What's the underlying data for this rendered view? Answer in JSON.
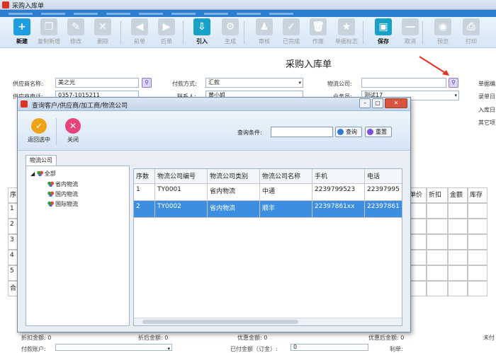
{
  "window": {
    "title": "采购入库单"
  },
  "toolbar": [
    {
      "label": "新建",
      "icon": "plus-icon",
      "state": "active",
      "color": "#1e9de0",
      "glyph": "+"
    },
    {
      "label": "复制新增",
      "icon": "copy-icon",
      "state": "disabled",
      "glyph": "❐"
    },
    {
      "label": "修改",
      "icon": "edit-icon",
      "state": "disabled",
      "glyph": "✎"
    },
    {
      "label": "删除",
      "icon": "delete-icon",
      "state": "disabled",
      "glyph": "✕"
    },
    {
      "label": "前单",
      "icon": "prev-icon",
      "state": "disabled",
      "glyph": "◀"
    },
    {
      "label": "后单",
      "icon": "next-icon",
      "state": "disabled",
      "glyph": "▶"
    },
    {
      "label": "引入",
      "icon": "import-icon",
      "state": "active",
      "color": "#19a2c9",
      "glyph": "⇩"
    },
    {
      "label": "生成",
      "icon": "generate-icon",
      "state": "disabled",
      "glyph": "⚙"
    },
    {
      "label": "审核",
      "icon": "audit-icon",
      "state": "disabled",
      "glyph": "♟"
    },
    {
      "label": "已完成",
      "icon": "check-icon",
      "state": "disabled",
      "glyph": "✓"
    },
    {
      "label": "作废",
      "icon": "void-icon",
      "state": "disabled",
      "glyph": "🗑"
    },
    {
      "label": "单据标志",
      "icon": "star-icon",
      "state": "disabled",
      "glyph": "★"
    },
    {
      "label": "保存",
      "icon": "save-icon",
      "state": "active",
      "color": "#19a2c9",
      "glyph": "▣"
    },
    {
      "label": "取消",
      "icon": "cancel-icon",
      "state": "disabled",
      "glyph": "—"
    },
    {
      "label": "预览",
      "icon": "preview-icon",
      "state": "disabled",
      "glyph": "◉"
    },
    {
      "label": "打印",
      "icon": "print-icon",
      "state": "disabled",
      "glyph": "⎙"
    }
  ],
  "form": {
    "title": "采购入库单",
    "supplier_name_label": "供应商名称:",
    "supplier_name": "美之光",
    "supplier_phone_label": "供应商电话:",
    "supplier_phone": "0357-1015211",
    "payment_label": "付款方式:",
    "payment": "汇款",
    "contact_label": "联系人:",
    "contact": "黄小姐",
    "logistics_label": "物流公司:",
    "logistics": "",
    "salesman_label": "业务员:",
    "salesman": "测试17",
    "receipt_no_label": "单据编",
    "entry_label": "录单日",
    "in_date_label": "入库日",
    "other_label": "其它项"
  },
  "product_grid": {
    "headers": [
      "序",
      "单价",
      "折扣",
      "金额",
      "库存"
    ],
    "rows": [
      "1",
      "2",
      "3",
      "4",
      "5"
    ],
    "total_label": "合"
  },
  "footer": {
    "discounted_amount_label": "折扣金额:",
    "discounted_amount": "0",
    "after_discount_label": "折后金额:",
    "after_discount": "0",
    "promo_amount_label": "优惠金额:",
    "promo_amount": "0",
    "after_promo_label": "优惠后金额:",
    "after_promo": "0",
    "unpaid_label": "未付",
    "pay_account_label": "付款账户:",
    "paid_amount_label": "已付金额（订金）:",
    "paid_amount": "0",
    "maker_label": "制单:"
  },
  "dialog": {
    "title": "查询客户/供应商/加工商/物流公司",
    "return_label": "返回选中",
    "close_label": "关闭",
    "query_label": "查询条件:",
    "query_value": "",
    "search_label": "查询",
    "reset_label": "重置",
    "tab_label": "物流公司",
    "tree": {
      "root": "全部",
      "children": [
        "省内物流",
        "国内物流",
        "国际物流"
      ]
    },
    "columns": [
      "序数",
      "物流公司编号",
      "物流公司类别",
      "物流公司名称",
      "手机",
      "电话"
    ],
    "rows": [
      [
        "1",
        "TY0001",
        "省内物流",
        "中通",
        "2239799523",
        "22397995"
      ],
      [
        "2",
        "TY0002",
        "省内物流",
        "顺丰",
        "22397861xx",
        "22397861"
      ]
    ],
    "selected_row": 2
  }
}
